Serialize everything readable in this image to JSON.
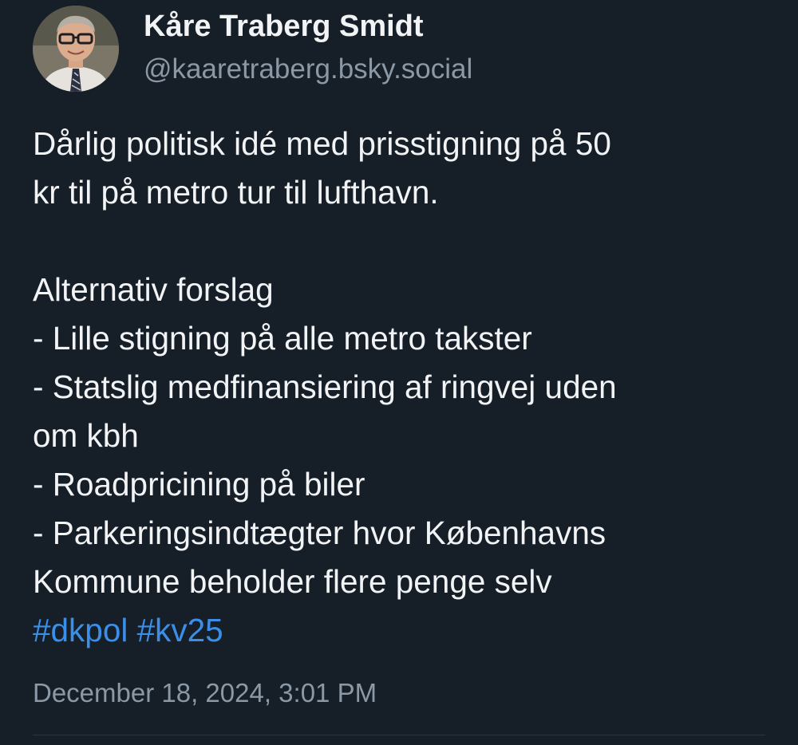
{
  "author": {
    "display_name": "Kåre Traberg Smidt",
    "handle": "@kaaretraberg.bsky.social",
    "avatar": "profile-photo"
  },
  "post": {
    "lines": [
      "Dårlig politisk idé med prisstigning på 50",
      "kr til på metro tur til lufthavn.",
      "",
      "Alternativ forslag",
      "- Lille stigning på alle metro takster",
      "- Statslig medfinansiering af ringvej uden",
      "om kbh",
      "- Roadpricining på biler",
      "- Parkeringsindtægter hvor Københavns",
      "Kommune beholder flere penge selv"
    ],
    "hashtags": [
      "#dkpol",
      "#kv25"
    ],
    "timestamp": "December 18, 2024, 3:01 PM"
  },
  "colors": {
    "background": "#161e27",
    "text": "#f1f3f5",
    "muted": "#8b98a5",
    "link": "#3b8fe8"
  }
}
